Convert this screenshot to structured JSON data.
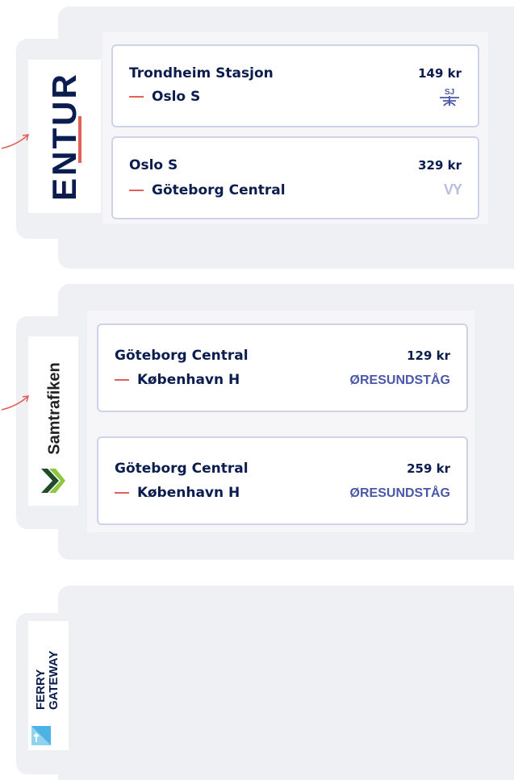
{
  "providers": [
    {
      "logo": "ENTUR",
      "trips": [
        {
          "origin": "Trondheim Stasjon",
          "destination": "Oslo S",
          "price": "149 kr",
          "operator": "SJ"
        },
        {
          "origin": "Oslo S",
          "destination": "Göteborg Central",
          "price": "329 kr",
          "operator": "VY"
        }
      ]
    },
    {
      "logo": "Samtrafiken",
      "trips": [
        {
          "origin": "Göteborg Central",
          "destination": "København H",
          "price": "129 kr",
          "operator": "ØRESUNDSTÅG"
        },
        {
          "origin": "Göteborg Central",
          "destination": "København H",
          "price": "259 kr",
          "operator": "ØRESUNDSTÅG"
        }
      ]
    },
    {
      "logo_line1": "FERRY",
      "logo_line2": "GATEWAY"
    }
  ],
  "colors": {
    "accent": "#e0605a",
    "navy": "#0b1d4e",
    "operator_blue": "#4b58a8",
    "panel": "#eff0f3",
    "card_border": "#cfd3ea"
  }
}
